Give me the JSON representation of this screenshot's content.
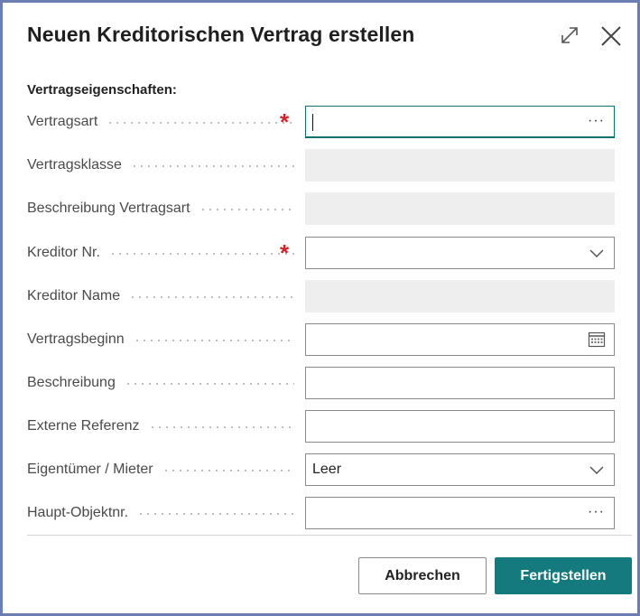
{
  "dialog": {
    "title": "Neuen Kreditorischen Vertrag erstellen",
    "section_heading": "Vertragseigenschaften:"
  },
  "fields": {
    "vertragsart": {
      "label": "Vertragsart",
      "value": "",
      "required": true
    },
    "vertragsklasse": {
      "label": "Vertragsklasse",
      "value": ""
    },
    "beschreibung_vertragsart": {
      "label": "Beschreibung Vertragsart",
      "value": ""
    },
    "kreditor_nr": {
      "label": "Kreditor Nr.",
      "value": "",
      "required": true
    },
    "kreditor_name": {
      "label": "Kreditor Name",
      "value": ""
    },
    "vertragsbeginn": {
      "label": "Vertragsbeginn",
      "value": ""
    },
    "beschreibung": {
      "label": "Beschreibung",
      "value": ""
    },
    "externe_referenz": {
      "label": "Externe Referenz",
      "value": ""
    },
    "eigentuemer_mieter": {
      "label": "Eigentümer / Mieter",
      "value": "Leer"
    },
    "haupt_objektnr": {
      "label": "Haupt-Objektnr.",
      "value": ""
    }
  },
  "lookup_glyph": "···",
  "required_glyph": "*",
  "buttons": {
    "cancel": "Abbrechen",
    "finish": "Fertigstellen"
  },
  "colors": {
    "accent": "#157a7d",
    "required": "#d81f26",
    "frame": "#6b7db3",
    "disabled_field": "#eeeeee"
  }
}
